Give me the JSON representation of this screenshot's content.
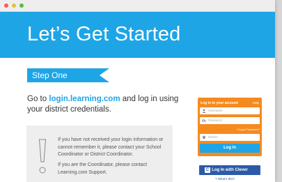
{
  "window": {
    "controls": [
      "close",
      "minimize",
      "zoom"
    ]
  },
  "banner": {
    "title": "Let’s Get Started"
  },
  "step": {
    "label": "Step One"
  },
  "intro": {
    "prefix": "Go to ",
    "link": "login.learning.com",
    "suffix": " and log in using your district credentials."
  },
  "notice": {
    "icon": "exclamation-icon",
    "para1": "If you have not received your login information or cannot remember it, please contact your School Coordinator or District Coordinator.",
    "para2": "If you are the Coordinator, please contact Learning.com Support."
  },
  "login": {
    "header": "Log in to your account",
    "help": "Help",
    "username_placeholder": "Username",
    "password_placeholder": "Password",
    "forgot": "Forgot Password?",
    "district_placeholder": "District",
    "submit": "Log In",
    "clever": "Log In with Clever",
    "whats_this": "What's this?"
  },
  "colors": {
    "brand_blue": "#1ea5e6",
    "login_orange": "#f58a1f",
    "clever_blue": "#2c5aa8"
  }
}
